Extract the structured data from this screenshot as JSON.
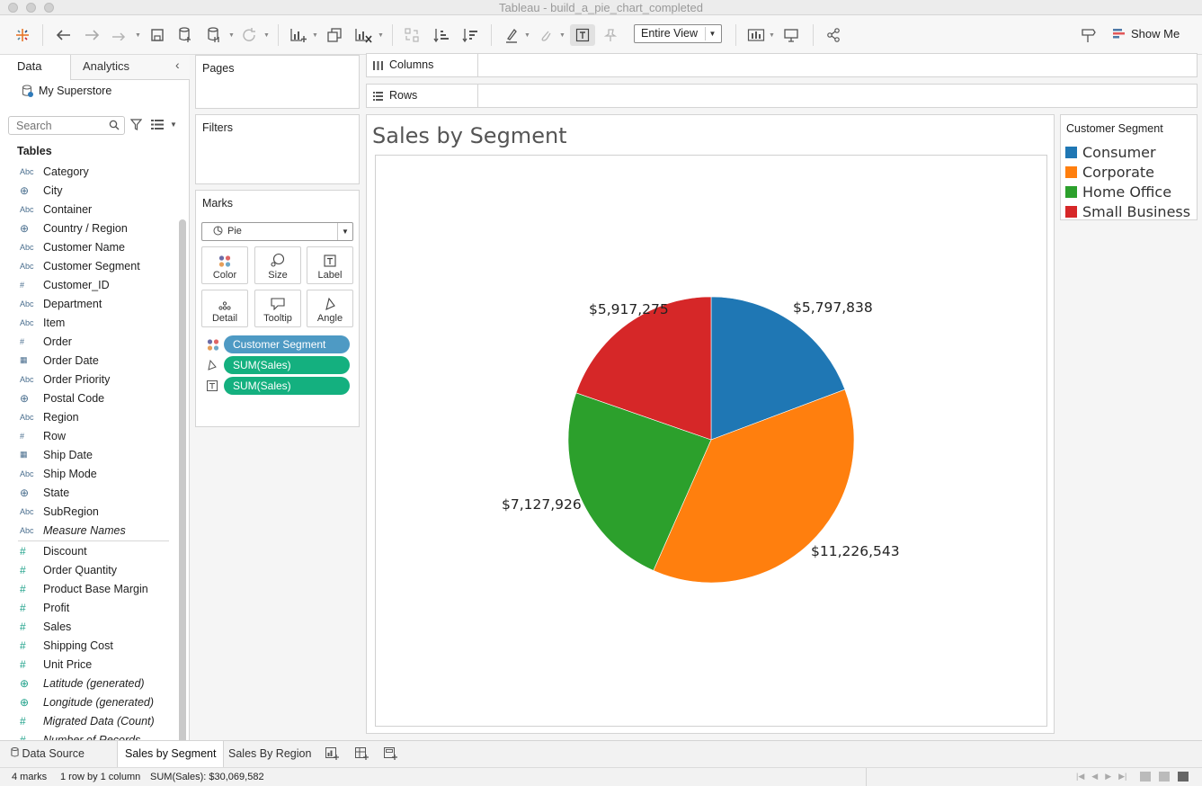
{
  "window": {
    "title": "Tableau - build_a_pie_chart_completed"
  },
  "toolbar": {
    "view_option": "Entire View",
    "show_me_label": "Show Me"
  },
  "left_panel": {
    "tab_data": "Data",
    "tab_analytics": "Analytics",
    "datasource": "My Superstore",
    "search_placeholder": "Search",
    "tables_header": "Tables",
    "dimensions": [
      {
        "type": "Abc",
        "name": "Category"
      },
      {
        "type": "geo",
        "name": "City"
      },
      {
        "type": "Abc",
        "name": "Container"
      },
      {
        "type": "geo",
        "name": "Country / Region"
      },
      {
        "type": "Abc",
        "name": "Customer Name"
      },
      {
        "type": "Abc",
        "name": "Customer Segment"
      },
      {
        "type": "#",
        "name": "Customer_ID"
      },
      {
        "type": "Abc",
        "name": "Department"
      },
      {
        "type": "Abc",
        "name": "Item"
      },
      {
        "type": "#",
        "name": "Order"
      },
      {
        "type": "date",
        "name": "Order Date"
      },
      {
        "type": "Abc",
        "name": "Order Priority"
      },
      {
        "type": "geo",
        "name": "Postal Code"
      },
      {
        "type": "Abc",
        "name": "Region"
      },
      {
        "type": "#",
        "name": "Row"
      },
      {
        "type": "date",
        "name": "Ship Date"
      },
      {
        "type": "Abc",
        "name": "Ship Mode"
      },
      {
        "type": "geo",
        "name": "State"
      },
      {
        "type": "Abc",
        "name": "SubRegion"
      },
      {
        "type": "Abc",
        "name": "Measure Names",
        "italic": true
      }
    ],
    "measures": [
      {
        "type": "#",
        "name": "Discount"
      },
      {
        "type": "#",
        "name": "Order Quantity"
      },
      {
        "type": "#",
        "name": "Product Base Margin"
      },
      {
        "type": "#",
        "name": "Profit"
      },
      {
        "type": "#",
        "name": "Sales"
      },
      {
        "type": "#",
        "name": "Shipping Cost"
      },
      {
        "type": "#",
        "name": "Unit Price"
      },
      {
        "type": "geo",
        "name": "Latitude (generated)",
        "italic": true
      },
      {
        "type": "geo",
        "name": "Longitude (generated)",
        "italic": true
      },
      {
        "type": "#",
        "name": "Migrated Data (Count)",
        "italic": true
      },
      {
        "type": "#",
        "name": "Number of Records",
        "italic": true
      }
    ]
  },
  "shelves": {
    "pages": "Pages",
    "filters": "Filters",
    "marks": "Marks",
    "columns": "Columns",
    "rows": "Rows",
    "mark_type": "Pie",
    "mark_buttons": [
      "Color",
      "Size",
      "Label",
      "Detail",
      "Tooltip",
      "Angle"
    ],
    "mark_pills": [
      "Customer Segment",
      "SUM(Sales)",
      "SUM(Sales)"
    ]
  },
  "worksheet": {
    "title": "Sales by Segment"
  },
  "legend": {
    "title": "Customer Segment",
    "items": [
      {
        "name": "Consumer",
        "color": "#1f77b4"
      },
      {
        "name": "Corporate",
        "color": "#ff7f0e"
      },
      {
        "name": "Home Office",
        "color": "#2ca02c"
      },
      {
        "name": "Small Business",
        "color": "#d62728"
      }
    ]
  },
  "chart_data": {
    "type": "pie",
    "title": "Sales by Segment",
    "categories": [
      "Consumer",
      "Corporate",
      "Home Office",
      "Small Business"
    ],
    "values": [
      5797838,
      11226543,
      7127926,
      5917275
    ],
    "labels": [
      "$5,797,838",
      "$11,226,543",
      "$7,127,926",
      "$5,917,275"
    ],
    "colors": [
      "#1f77b4",
      "#ff7f0e",
      "#2ca02c",
      "#d62728"
    ],
    "legend": "right"
  },
  "sheet_tabs": {
    "data_source": "Data Source",
    "tabs": [
      "Sales by Segment",
      "Sales By Region"
    ],
    "active": "Sales by Segment"
  },
  "status": {
    "marks": "4 marks",
    "dims": "1 row by 1 column",
    "sum": "SUM(Sales): $30,069,582"
  }
}
